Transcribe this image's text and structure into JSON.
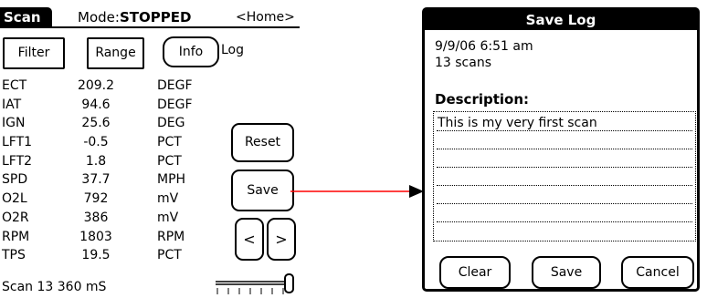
{
  "scan": {
    "tab_label": "Scan",
    "mode_prefix": "Mode:",
    "mode_value": "STOPPED",
    "home_label": "<Home>",
    "buttons": {
      "filter": "Filter",
      "range": "Range",
      "info": "Info",
      "log": "Log",
      "reset": "Reset",
      "save": "Save",
      "prev": "<",
      "next": ">"
    },
    "rows": [
      {
        "name": "ECT",
        "value": "209.2",
        "unit": "DEGF"
      },
      {
        "name": "IAT",
        "value": "94.6",
        "unit": "DEGF"
      },
      {
        "name": "IGN",
        "value": "25.6",
        "unit": "DEG"
      },
      {
        "name": "LFT1",
        "value": "-0.5",
        "unit": "PCT"
      },
      {
        "name": "LFT2",
        "value": "1.8",
        "unit": "PCT"
      },
      {
        "name": "SPD",
        "value": "37.7",
        "unit": "MPH"
      },
      {
        "name": "O2L",
        "value": "792",
        "unit": "mV"
      },
      {
        "name": "O2R",
        "value": "386",
        "unit": "mV"
      },
      {
        "name": "RPM",
        "value": "1803",
        "unit": "RPM"
      },
      {
        "name": "TPS",
        "value": "19.5",
        "unit": "PCT"
      }
    ],
    "status": "Scan  13 360 mS",
    "slider_level": 1.0
  },
  "save_log": {
    "title": "Save Log",
    "date": "9/9/06 6:51 am",
    "count": "13 scans",
    "description_label": "Description:",
    "description_text": "This is my very first scan",
    "buttons": {
      "clear": "Clear",
      "save": "Save",
      "cancel": "Cancel"
    }
  },
  "colors": {
    "arrow": "#ff0000"
  }
}
